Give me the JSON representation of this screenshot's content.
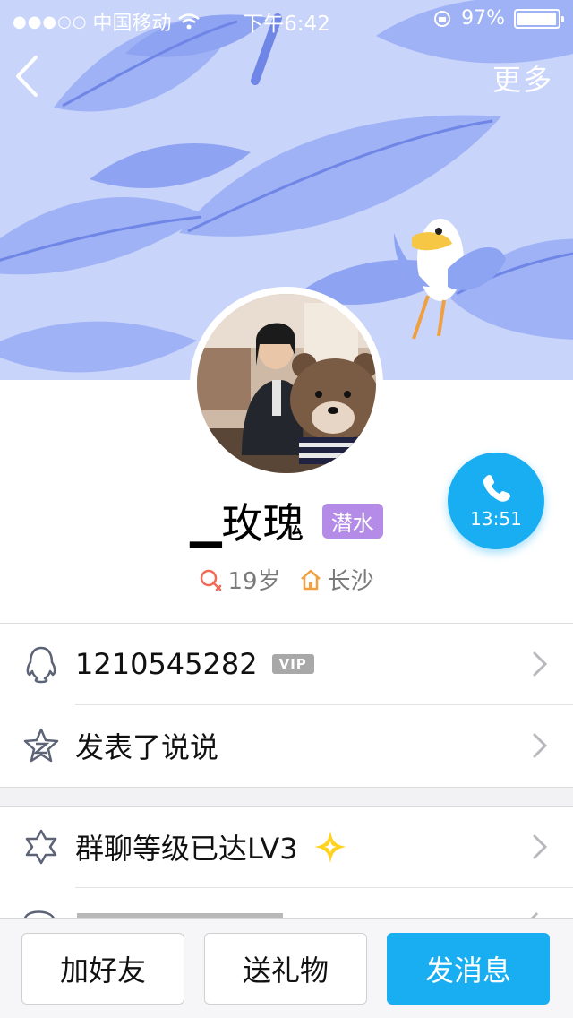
{
  "status_bar": {
    "signal_dots": "●●●○○",
    "carrier": "中国移动",
    "time": "下午6:42",
    "battery_percent": "97%",
    "battery_level": 0.97
  },
  "nav": {
    "more_label": "更多"
  },
  "profile": {
    "name": "▁玫瑰",
    "badge": "潜水",
    "age": "19岁",
    "city": "长沙"
  },
  "call": {
    "time": "13:51"
  },
  "list": {
    "qq_number": "1210545282",
    "vip_label": "VIP",
    "post_label": "发表了说说",
    "group_level_label": "群聊等级已达LV3"
  },
  "actions": {
    "add_friend": "加好友",
    "send_gift": "送礼物",
    "send_message": "发消息"
  },
  "colors": {
    "accent": "#19adf2",
    "banner_bg": "#c9d4fb",
    "badge_purple": "#b58be8"
  }
}
